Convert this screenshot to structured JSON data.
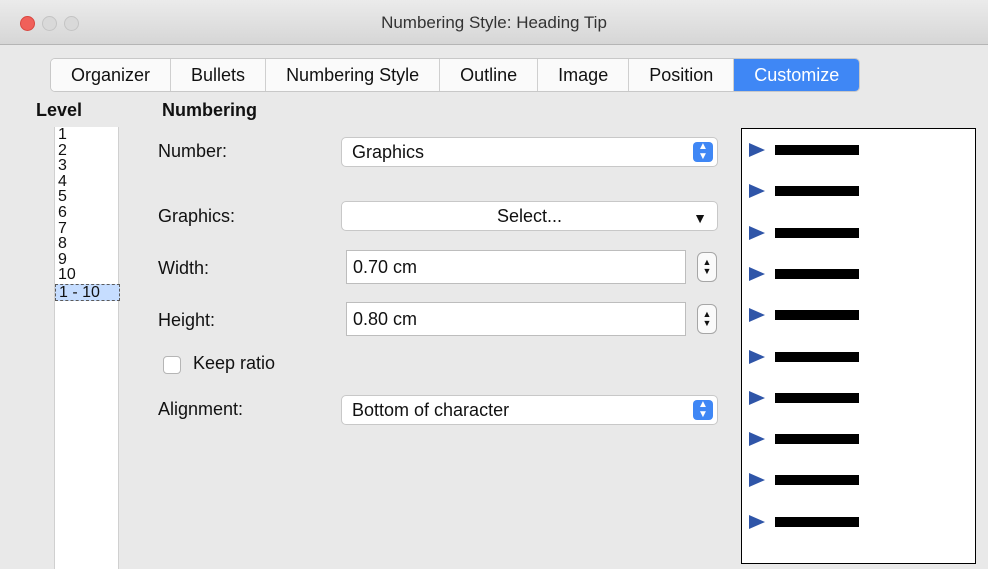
{
  "window": {
    "title": "Numbering Style: Heading Tip"
  },
  "tabs": [
    "Organizer",
    "Bullets",
    "Numbering Style",
    "Outline",
    "Image",
    "Position",
    "Customize"
  ],
  "active_tab": "Customize",
  "level": {
    "title": "Level",
    "items": [
      "1",
      "2",
      "3",
      "4",
      "5",
      "6",
      "7",
      "8",
      "9",
      "10"
    ],
    "selected": "1 - 10"
  },
  "numbering": {
    "title": "Numbering",
    "number_label": "Number:",
    "number_value": "Graphics",
    "graphics_label": "Graphics:",
    "graphics_button": "Select...",
    "width_label": "Width:",
    "width_value": "0.70 cm",
    "height_label": "Height:",
    "height_value": "0.80 cm",
    "keep_ratio_label": "Keep ratio",
    "keep_ratio_checked": false,
    "alignment_label": "Alignment:",
    "alignment_value": "Bottom of character"
  },
  "preview": {
    "rows": 10,
    "bullet_color": "#2f55a8"
  },
  "colors": {
    "accent": "#3f87f5",
    "close_button": "#f0605a"
  }
}
